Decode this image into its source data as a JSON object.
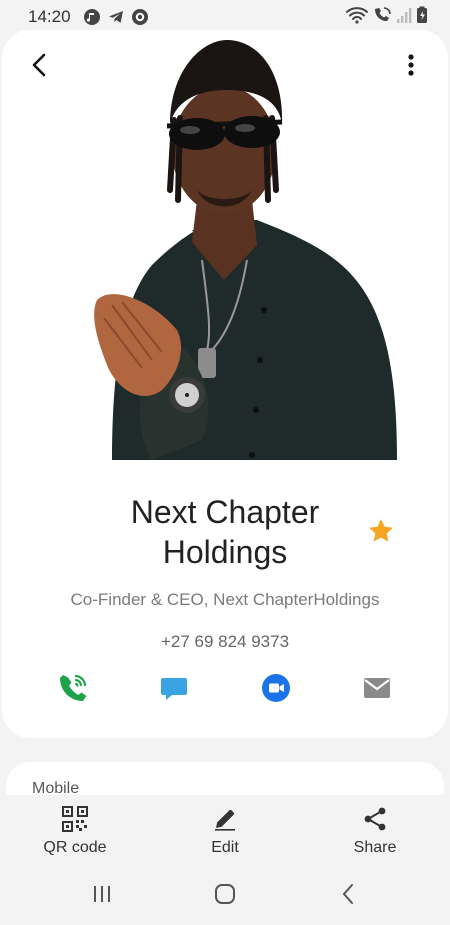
{
  "status_bar": {
    "time": "14:20",
    "left_icons": [
      "music-icon",
      "telegram-icon",
      "shield-icon"
    ],
    "right_icons": [
      "wifi-icon",
      "wifi-call-icon",
      "signal-icon",
      "battery-icon"
    ]
  },
  "header": {
    "back_icon": "arrow-back-icon",
    "more_icon": "more-vertical-icon"
  },
  "contact": {
    "name": "Next Chapter Holdings",
    "favorite": true,
    "job_title": "Co-Finder & CEO, Next ChapterHoldings",
    "phone": "+27 69 824 9373"
  },
  "actions": [
    {
      "name": "wifi-call",
      "icon": "wifi-call-icon",
      "color": "#1fa34a"
    },
    {
      "name": "message",
      "icon": "message-icon",
      "color": "#3aa3e3"
    },
    {
      "name": "video-call",
      "icon": "video-call-icon",
      "color": "#1a73e8"
    },
    {
      "name": "email",
      "icon": "email-icon",
      "color": "#8a8a8a"
    }
  ],
  "details": {
    "mobile_label": "Mobile"
  },
  "bottom_bar": {
    "qr_label": "QR code",
    "edit_label": "Edit",
    "share_label": "Share"
  },
  "colors": {
    "star": "#f4a622",
    "background": "#f3f3f3",
    "card": "#ffffff"
  }
}
